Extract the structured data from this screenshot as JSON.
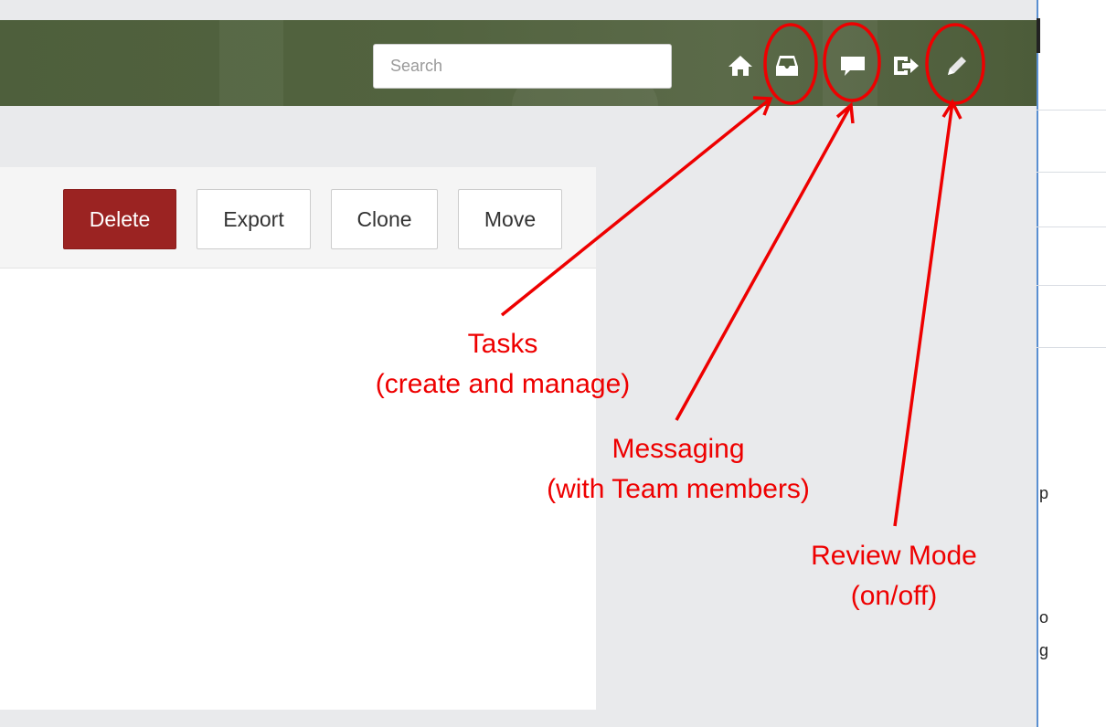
{
  "navbar": {
    "search_placeholder": "Search",
    "icons": [
      {
        "name": "home-icon"
      },
      {
        "name": "inbox-tray-icon"
      },
      {
        "name": "chat-bubble-icon"
      },
      {
        "name": "sign-out-icon"
      },
      {
        "name": "pencil-icon"
      }
    ]
  },
  "toolbar": {
    "delete_label": "Delete",
    "export_label": "Export",
    "clone_label": "Clone",
    "move_label": "Move"
  },
  "right_edge_text": [
    "p",
    "o",
    "g"
  ],
  "annotations": {
    "tasks": {
      "title": "Tasks",
      "subtitle": "(create and manage)"
    },
    "messaging": {
      "title": "Messaging",
      "subtitle": "(with Team members)"
    },
    "review": {
      "title": "Review Mode",
      "subtitle": "(on/off)"
    }
  },
  "colors": {
    "navbar": "#52633f",
    "danger_button": "#9b2322",
    "annotation": "#ee0000"
  }
}
